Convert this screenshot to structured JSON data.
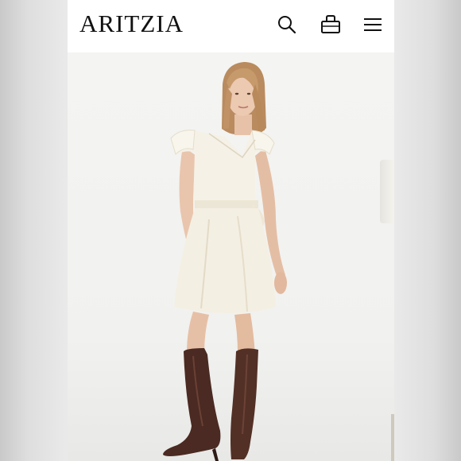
{
  "header": {
    "brand": "ARITZIA",
    "icons": {
      "search": "search-icon",
      "bag": "shopping-bag-icon",
      "menu": "hamburger-menu-icon"
    }
  },
  "product": {
    "image": "product-photo"
  },
  "colors": {
    "header_bg": "#ffffff",
    "photo_bg": "#f2f2f0",
    "dress": "#f3efe3",
    "boots": "#4a2a22",
    "outer": "#d9d9d9"
  }
}
